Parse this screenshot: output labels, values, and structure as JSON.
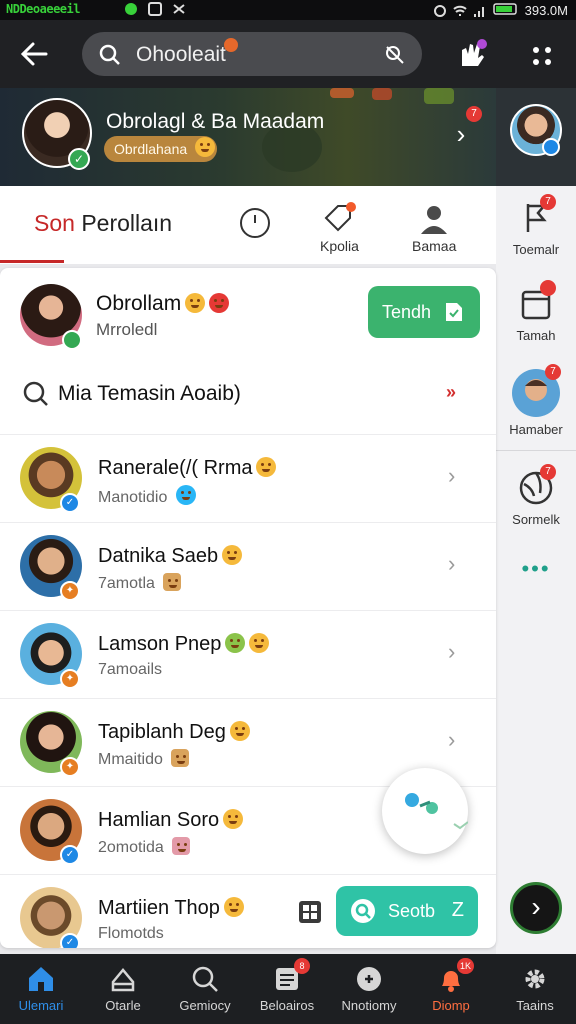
{
  "status_bar": {
    "carrier": "NDDeoaeeeil",
    "time": "393.0M"
  },
  "top_bar": {
    "search_text": "Ohooleait"
  },
  "banner": {
    "name": "Obrolagl & Ba Maadam",
    "tag": "Obrdlahana"
  },
  "tabs": {
    "main_prefix": "Son",
    "main_rest": " Perollaın",
    "items": [
      {
        "label": "Kpolia"
      },
      {
        "label": "Bamaa"
      }
    ]
  },
  "me": {
    "name": "Obrollam",
    "sub": "Mrroledl",
    "button": "Tendh"
  },
  "section": {
    "label": "Mia Temasin Aoaib)",
    "more": "»"
  },
  "contacts": [
    {
      "name": "Ranerale(/( Rrma",
      "sub": "Manotidio"
    },
    {
      "name": "Datnika Saeb",
      "sub": "7amotla"
    },
    {
      "name": "Lamson Pnep",
      "sub": "7amoails"
    },
    {
      "name": "Tapiblanh Deg",
      "sub": "Mmaitido"
    },
    {
      "name": "Hamlian Soro",
      "sub": "2omotida"
    },
    {
      "name": "Martiien Thop",
      "sub": "Flomotds"
    }
  ],
  "fab": {
    "label": "Seotb",
    "suffix": "Z"
  },
  "rail": {
    "items": [
      {
        "label": "Toemalr"
      },
      {
        "label": "Tamah"
      },
      {
        "label": "Hamaber"
      },
      {
        "label": "Sormelk"
      }
    ],
    "dots": "•••"
  },
  "bottom_nav": [
    {
      "label": "Ulemari",
      "state": "active"
    },
    {
      "label": "Otarle",
      "state": ""
    },
    {
      "label": "Gemiocy",
      "state": ""
    },
    {
      "label": "Beloairos",
      "state": "",
      "badge": "8"
    },
    {
      "label": "Nnotiomy",
      "state": ""
    },
    {
      "label": "Diomp",
      "state": "alert",
      "badge": "1K"
    },
    {
      "label": "Taains",
      "state": ""
    }
  ],
  "colors": {
    "accent": "#c62828",
    "green": "#3bb36e",
    "teal": "#2fc3a6",
    "nav_active": "#2f8ee8"
  }
}
